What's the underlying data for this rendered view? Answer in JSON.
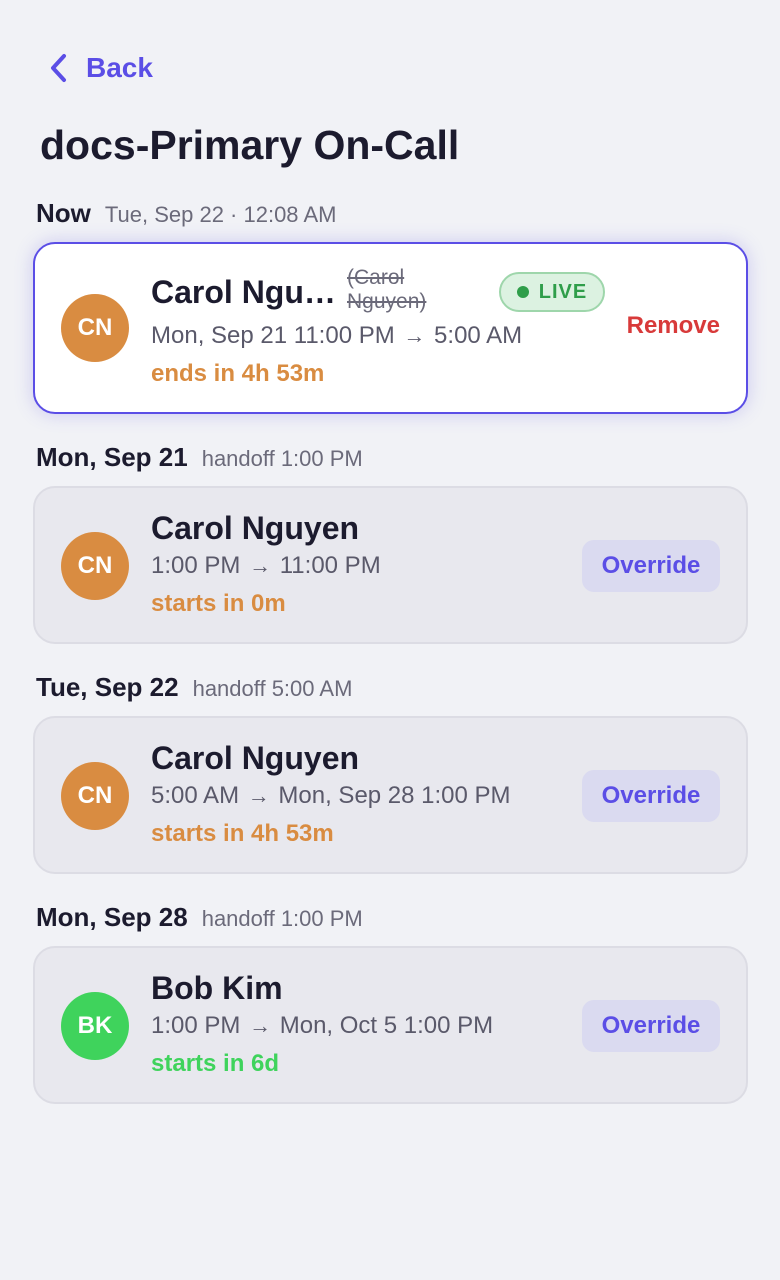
{
  "header": {
    "back_label": "Back",
    "title": "docs-Primary On-Call"
  },
  "now": {
    "label": "Now",
    "meta": "Tue, Sep 22 · 12:08 AM",
    "card": {
      "initials": "CN",
      "avatar_color": "#d98c41",
      "name": "Carol Ngu…",
      "original_name": "(Carol Nguyen)",
      "live_label": "LIVE",
      "start": "Mon, Sep 21 11:00 PM",
      "arrow": "→",
      "end": "5:00 AM",
      "status": "ends in 4h 53m",
      "status_color": "#d98c41",
      "action": "Remove"
    }
  },
  "shifts": [
    {
      "label": "Mon, Sep 21",
      "meta": "handoff 1:00 PM",
      "initials": "CN",
      "avatar_color": "#d98c41",
      "name": "Carol Nguyen",
      "start": "1:00 PM",
      "arrow": "→",
      "end": "11:00 PM",
      "status": "starts in 0m",
      "status_color": "#d98c41",
      "action": "Override"
    },
    {
      "label": "Tue, Sep 22",
      "meta": "handoff 5:00 AM",
      "initials": "CN",
      "avatar_color": "#d98c41",
      "name": "Carol Nguyen",
      "start": "5:00 AM",
      "arrow": "→",
      "end": "Mon, Sep 28 1:00 PM",
      "status": "starts in 4h 53m",
      "status_color": "#d98c41",
      "action": "Override"
    },
    {
      "label": "Mon, Sep 28",
      "meta": "handoff 1:00 PM",
      "initials": "BK",
      "avatar_color": "#3fd35c",
      "name": "Bob Kim",
      "start": "1:00 PM",
      "arrow": "→",
      "end": "Mon, Oct 5 1:00 PM",
      "status": "starts in 6d",
      "status_color": "#3fd35c",
      "action": "Override"
    }
  ],
  "colors": {
    "accent": "#5b4ee6",
    "danger": "#d83a3a",
    "live": "#2f9e4a"
  }
}
